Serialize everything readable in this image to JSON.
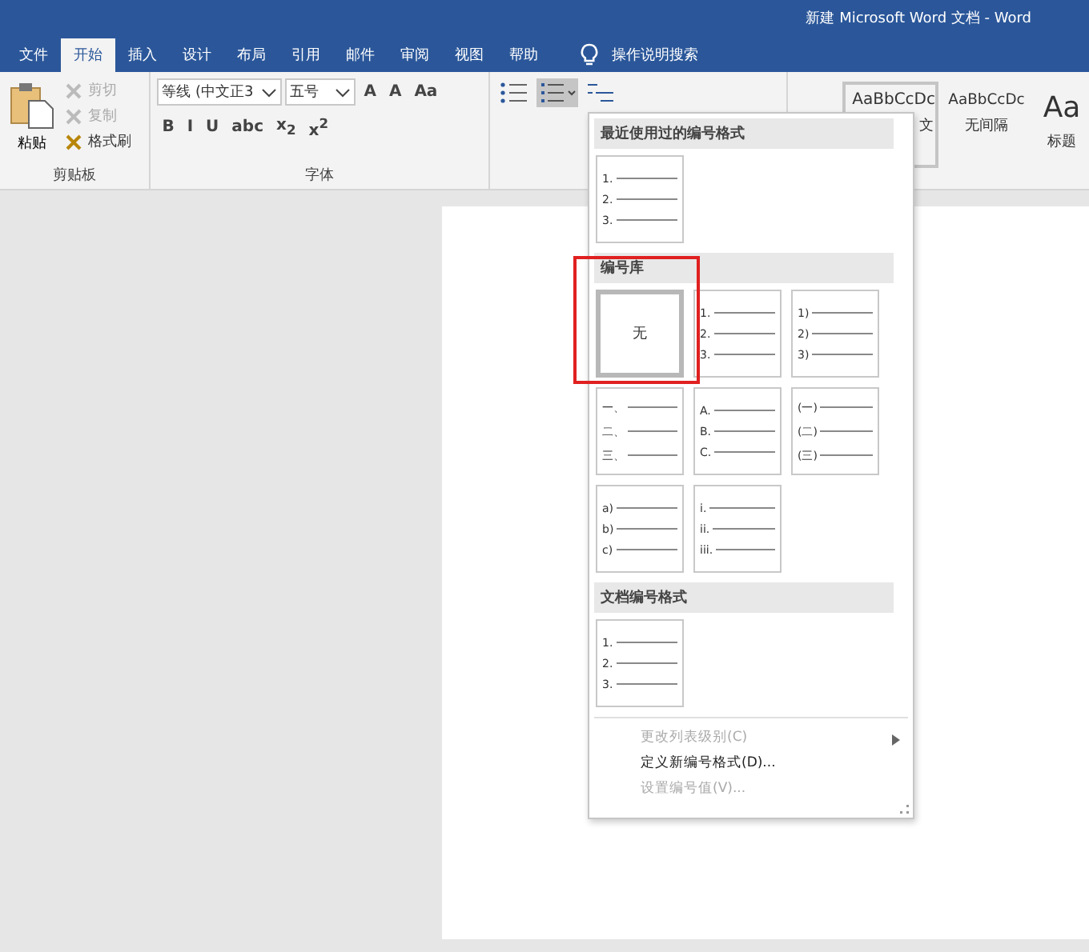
{
  "window": {
    "title": "新建 Microsoft Word 文档  -  Word"
  },
  "tabs": [
    {
      "label": "文件",
      "selected": false
    },
    {
      "label": "开始",
      "selected": true
    },
    {
      "label": "插入",
      "selected": false
    },
    {
      "label": "设计",
      "selected": false
    },
    {
      "label": "布局",
      "selected": false
    },
    {
      "label": "引用",
      "selected": false
    },
    {
      "label": "邮件",
      "selected": false
    },
    {
      "label": "审阅",
      "selected": false
    },
    {
      "label": "视图",
      "selected": false
    },
    {
      "label": "帮助",
      "selected": false
    }
  ],
  "search": {
    "placeholder": "操作说明搜索"
  },
  "clipboard": {
    "paste": "粘贴",
    "items": [
      {
        "label": "剪切",
        "disabled": true
      },
      {
        "label": "复制",
        "disabled": true
      },
      {
        "label": "格式刷",
        "disabled": false
      }
    ],
    "label": "剪贴板"
  },
  "font": {
    "name": "等线 (中文正3",
    "size": "五号",
    "row1_buttons": [
      "A",
      "A",
      "Aa"
    ],
    "row2_buttons": [
      "B",
      "I",
      "U",
      "abc",
      "x$_{2}$",
      "x$^{2}$"
    ],
    "label": "字体"
  },
  "styles": [
    {
      "preview": "AaBbCcDc",
      "name": "文",
      "selected": true
    },
    {
      "preview": "AaBbCcDc",
      "name": "无间隔",
      "selected": false
    },
    {
      "preview": "Aa",
      "name": "标题",
      "selected": false
    }
  ],
  "numbering_menu": {
    "sections": [
      {
        "title": "最近使用过的编号格式",
        "tiles": [
          {
            "kind": "list",
            "numbers": [
              "1.",
              "2.",
              "3."
            ],
            "selected": false
          }
        ]
      },
      {
        "title": "编号库",
        "tiles": [
          {
            "kind": "none",
            "label": "无",
            "selected": true
          },
          {
            "kind": "list",
            "numbers": [
              "1.",
              "2.",
              "3."
            ],
            "selected": false
          },
          {
            "kind": "list",
            "numbers": [
              "1)",
              "2)",
              "3)"
            ],
            "selected": false
          },
          {
            "kind": "list",
            "numbers": [
              "一、",
              "二、",
              "三、"
            ],
            "selected": false
          },
          {
            "kind": "list",
            "numbers": [
              "A.",
              "B.",
              "C."
            ],
            "selected": false
          },
          {
            "kind": "list",
            "numbers": [
              "(一)",
              "(二)",
              "(三)"
            ],
            "selected": false
          },
          {
            "kind": "list",
            "numbers": [
              "a)",
              "b)",
              "c)"
            ],
            "selected": false
          },
          {
            "kind": "list",
            "numbers": [
              "i.",
              "ii.",
              "iii."
            ],
            "selected": false
          }
        ]
      },
      {
        "title": "文档编号格式",
        "tiles": [
          {
            "kind": "list",
            "numbers": [
              "1.",
              "2.",
              "3."
            ],
            "selected": false
          }
        ]
      }
    ],
    "items": [
      {
        "label": "更改列表级别(C)",
        "disabled": true,
        "submenu": true
      },
      {
        "label": "定义新编号格式(D)...",
        "disabled": false,
        "submenu": false
      },
      {
        "label": "设置编号值(V)...",
        "disabled": true,
        "submenu": false
      }
    ]
  }
}
